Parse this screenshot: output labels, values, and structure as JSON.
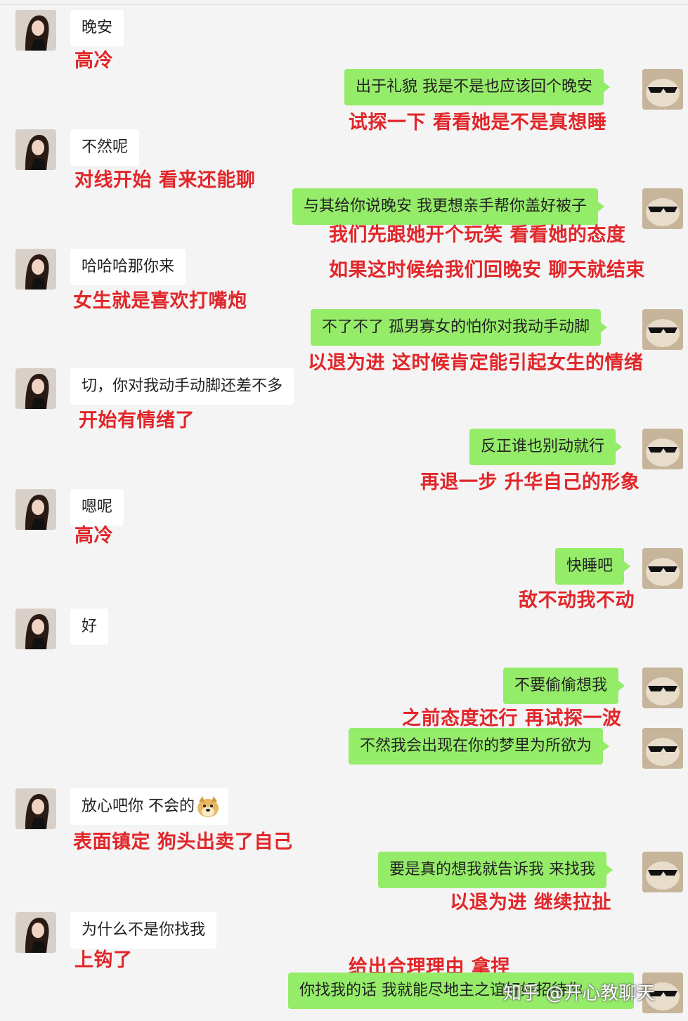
{
  "messages": [
    {
      "side": "left",
      "text": "晚安",
      "note": "高冷"
    },
    {
      "side": "right",
      "text": "出于礼貌 我是不是也应该回个晚安",
      "note": "试探一下 看看她是不是真想睡"
    },
    {
      "side": "left",
      "text": "不然呢",
      "note": "对线开始 看来还能聊"
    },
    {
      "side": "right",
      "text": "与其给你说晚安 我更想亲手帮你盖好被子",
      "note": "我们先跟她开个玩笑 看看她的态度",
      "note2": "如果这时候给我们回晚安 聊天就结束"
    },
    {
      "side": "left",
      "text": "哈哈哈那你来",
      "note": "女生就是喜欢打嘴炮"
    },
    {
      "side": "right",
      "text": "不了不了 孤男寡女的怕你对我动手动脚",
      "note": "以退为进 这时候肯定能引起女生的情绪"
    },
    {
      "side": "left",
      "text": "切，你对我动手动脚还差不多",
      "note": "开始有情绪了"
    },
    {
      "side": "right",
      "text": "反正谁也别动就行",
      "note": "再退一步 升华自己的形象"
    },
    {
      "side": "left",
      "text": "嗯呢",
      "note": "高冷"
    },
    {
      "side": "right",
      "text": "快睡吧",
      "note": "敌不动我不动"
    },
    {
      "side": "left",
      "text": "好"
    },
    {
      "side": "right",
      "text": "不要偷偷想我",
      "note": "之前态度还行 再试探一波"
    },
    {
      "side": "right",
      "text": "不然我会出现在你的梦里为所欲为"
    },
    {
      "side": "left",
      "text": "放心吧你 不会的",
      "note": "表面镇定 狗头出卖了自己"
    },
    {
      "side": "right",
      "text": "要是真的想我就告诉我 来找我",
      "note": "以退为进 继续拉扯"
    },
    {
      "side": "left",
      "text": "为什么不是你找我",
      "note": "上钩了"
    },
    {
      "side": "right",
      "text": "你找我的话 我就能尽地主之谊好好招待你",
      "note_above": "给出合理理由 拿捏"
    }
  ],
  "watermark": "知乎 @开心教聊天",
  "colors": {
    "green_bubble": "#95ec69",
    "white_bubble": "#ffffff",
    "annotation_red": "#e1262a",
    "background": "#f4f4f4"
  },
  "icons": {
    "left_avatar": "girl-avatar-icon",
    "right_avatar": "sunglasses-cat-avatar-icon",
    "emoji": "doge-emoji-icon"
  }
}
